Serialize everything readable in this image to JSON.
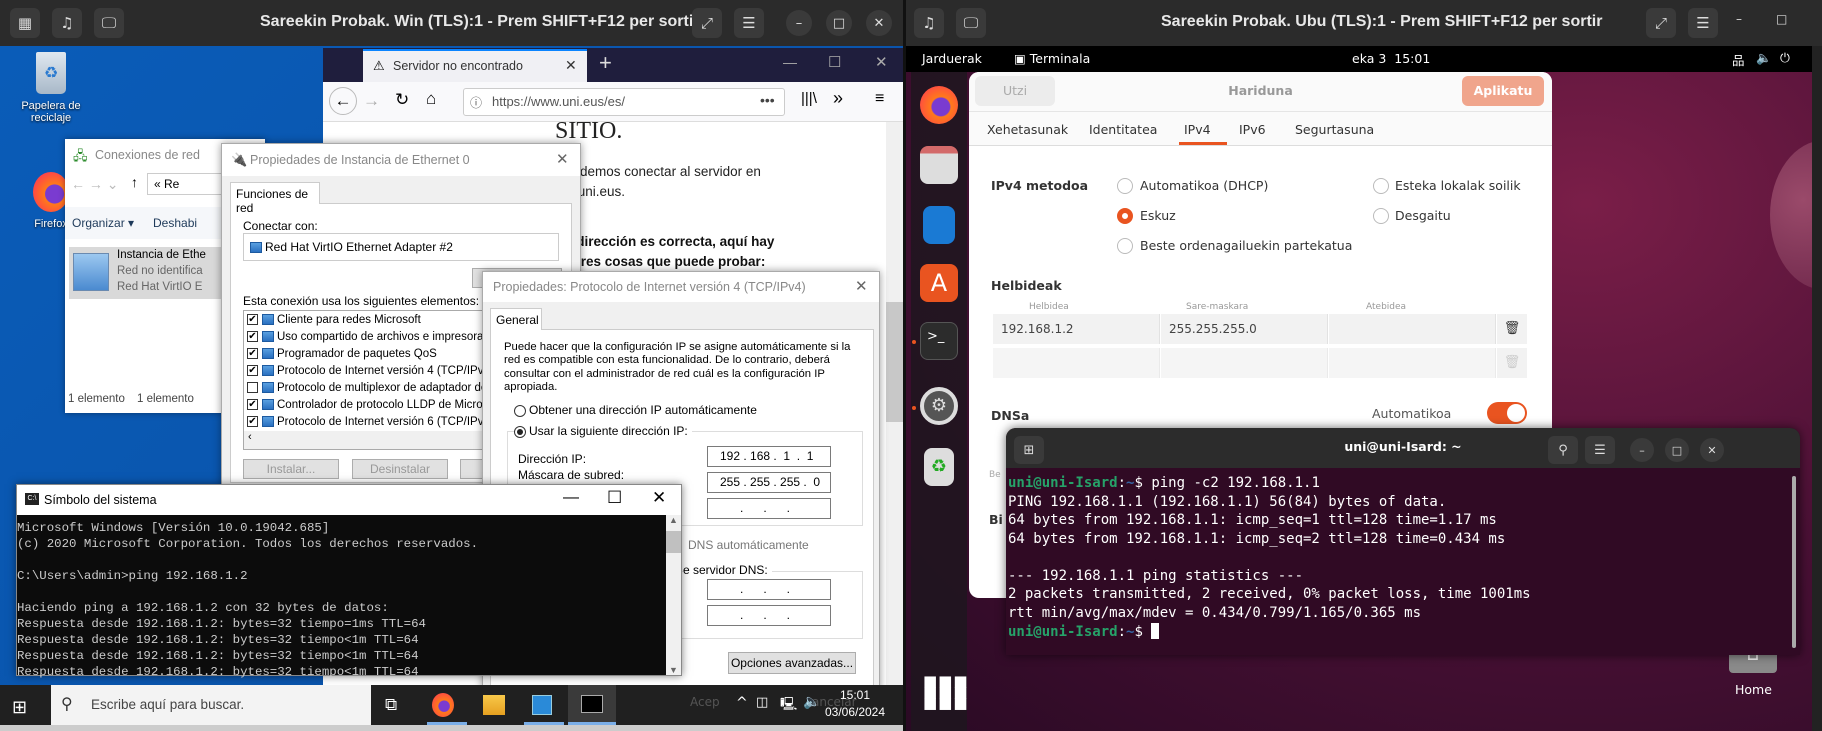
{
  "win_vm": {
    "title": "Sareekin Probak. Win (TLS):1 - Prem SHIFT+F12 per sortir"
  },
  "ubu_vm": {
    "title": "Sareekin Probak. Ubu (TLS):1 - Prem SHIFT+F12 per sortir"
  },
  "win_desktop": {
    "icons": [
      {
        "label": "Papelera de reciclaje",
        "icon": "recycle-bin-icon"
      },
      {
        "label": "Firefox",
        "icon": "firefox-icon"
      }
    ]
  },
  "firefox": {
    "tab_title": "Servidor no encontrado",
    "url": "https://www.uni.eus/es/",
    "content": [
      "SITIO.",
      "podemos conectar al servidor en",
      "w.uni.eus.",
      "a dirección es correcta, aquí hay",
      "s tres cosas que puede probar:"
    ]
  },
  "net_connections": {
    "title": "Conexiones de red",
    "breadcrumb": "« Re",
    "toolbar": [
      "Organizar ▾",
      "Deshabi"
    ],
    "item": {
      "name": "Instancia de Ethe",
      "status": "Red no identifica",
      "adapter": "Red Hat VirtIO E"
    },
    "status": [
      "1 elemento",
      "1 elemento"
    ]
  },
  "eth_props": {
    "title": "Propiedades de Instancia de Ethernet 0",
    "tab": "Funciones de red",
    "connect_with": "Conectar con:",
    "adapter": "Red Hat VirtIO Ethernet Adapter #2",
    "list_label": "Esta conexión usa los siguientes elementos:",
    "items": [
      {
        "label": "Cliente para redes Microsoft",
        "checked": true
      },
      {
        "label": "Uso compartido de archivos e impresoras",
        "checked": true
      },
      {
        "label": "Programador de paquetes QoS",
        "checked": true
      },
      {
        "label": "Protocolo de Internet versión 4 (TCP/IPv4",
        "checked": true
      },
      {
        "label": "Protocolo de multiplexor de adaptador de r",
        "checked": false
      },
      {
        "label": "Controlador de protocolo LLDP de Microso",
        "checked": true
      },
      {
        "label": "Protocolo de Internet versión 6 (TCP/IPv6",
        "checked": true
      }
    ],
    "buttons": [
      "Instalar...",
      "Desinstalar"
    ]
  },
  "ipv4_props": {
    "title": "Propiedades: Protocolo de Internet versión 4 (TCP/IPv4)",
    "tab": "General",
    "description": "Puede hacer que la configuración IP se asigne automáticamente si la red es compatible con esta funcionalidad. De lo contrario, deberá consultar con el administrador de red cuál es la configuración IP apropiada.",
    "radio_auto": "Obtener una dirección IP automáticamente",
    "radio_manual": "Usar la siguiente dirección IP:",
    "ip_label": "Dirección IP:",
    "ip_value": "192 . 168 .  1  .  1",
    "mask_label": "Máscara de subred:",
    "mask_value": "255 . 255 . 255 .  0",
    "empty_ip": "      .      .      .",
    "dns_auto": "DNS automáticamente",
    "dns_manual": "e servidor DNS:",
    "advanced": "Opciones avanzadas...",
    "ok": "Acep",
    "cancel": "ancelar"
  },
  "cmd": {
    "title": "Símbolo del sistema",
    "lines": [
      "Microsoft Windows [Versión 10.0.19042.685]",
      "(c) 2020 Microsoft Corporation. Todos los derechos reservados.",
      "",
      "C:\\Users\\admin>ping 192.168.1.2",
      "",
      "Haciendo ping a 192.168.1.2 con 32 bytes de datos:",
      "Respuesta desde 192.168.1.2: bytes=32 tiempo=1ms TTL=64",
      "Respuesta desde 192.168.1.2: bytes=32 tiempo<1m TTL=64",
      "Respuesta desde 192.168.1.2: bytes=32 tiempo<1m TTL=64",
      "Respuesta desde 192.168.1.2: bytes=32 tiempo<1m TTL=64"
    ]
  },
  "taskbar": {
    "search_placeholder": "Escribe aquí para buscar.",
    "time": "15:01",
    "date": "03/06/2024"
  },
  "ubuntu_topbar": {
    "activities": "Jarduerak",
    "app": "Terminala",
    "clock": "eka 3  15:01"
  },
  "net_settings": {
    "cancel": "Utzi",
    "title": "Hariduna",
    "apply": "Aplikatu",
    "tabs": [
      "Xehetasunak",
      "Identitatea",
      "IPv4",
      "IPv6",
      "Segurtasuna"
    ],
    "active_tab": "IPv4",
    "method_label": "IPv4 metodoa",
    "methods": [
      {
        "label": "Automatikoa (DHCP)",
        "selected": false
      },
      {
        "label": "Eskuz",
        "selected": true
      },
      {
        "label": "Beste ordenagailuekin partekatua",
        "selected": false
      },
      {
        "label": "Esteka lokalak soilik",
        "selected": false
      },
      {
        "label": "Desgaitu",
        "selected": false
      }
    ],
    "addresses_label": "Helbideak",
    "columns": [
      "Helbidea",
      "Sare-maskara",
      "Atebidea"
    ],
    "rows": [
      [
        "192.168.1.2",
        "255.255.255.0",
        ""
      ],
      [
        "",
        "",
        ""
      ]
    ],
    "dns_label": "DNSa",
    "dns_auto_label": "Automatikoa",
    "dns_auto": true,
    "partial": [
      "Be",
      "Bi"
    ],
    "accent": "#e95420"
  },
  "terminal": {
    "title": "uni@uni-Isard: ~",
    "user_host": "uni@uni-Isard",
    "path": "~",
    "command": "ping -c2 192.168.1.1",
    "output": [
      "PING 192.168.1.1 (192.168.1.1) 56(84) bytes of data.",
      "64 bytes from 192.168.1.1: icmp_seq=1 ttl=128 time=1.17 ms",
      "64 bytes from 192.168.1.1: icmp_seq=2 ttl=128 time=0.434 ms",
      "",
      "--- 192.168.1.1 ping statistics ---",
      "2 packets transmitted, 2 received, 0% packet loss, time 1001ms",
      "rtt min/avg/max/mdev = 0.434/0.799/1.165/0.365 ms"
    ]
  },
  "ubu_desktop": {
    "home_label": "Home"
  }
}
